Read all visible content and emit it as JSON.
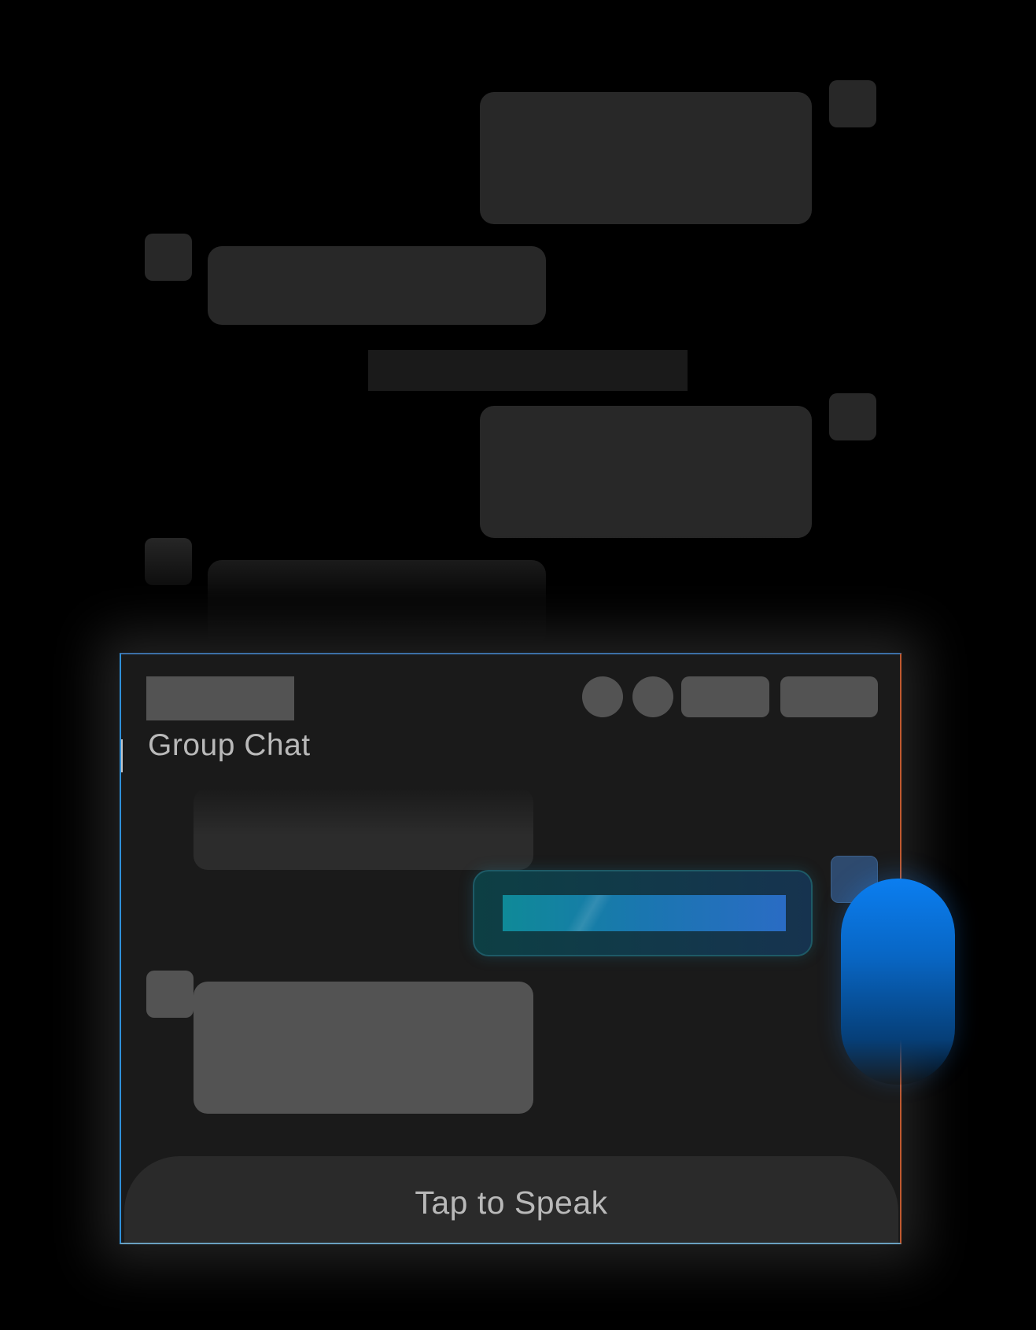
{
  "panel": {
    "title": "Group Chat"
  },
  "voice_input": {
    "label": "Tap to Speak"
  },
  "colors": {
    "background": "#000000",
    "panel": "#1a1a1a",
    "placeholder": "#535353",
    "active_bubble_accent": "#0f8a98",
    "thumb_accent": "#0b7ef0"
  }
}
